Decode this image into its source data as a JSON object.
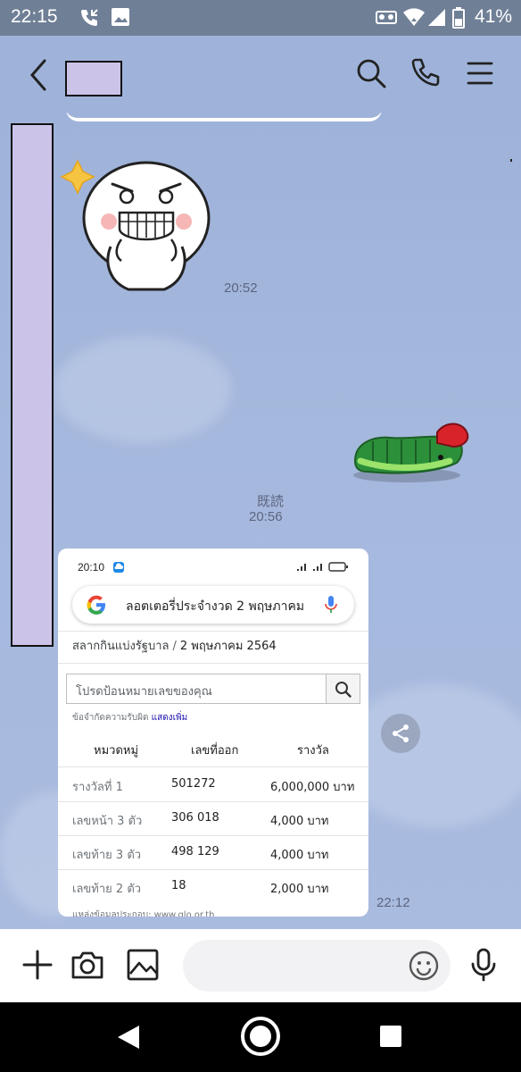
{
  "status_bar": {
    "time": "22:15",
    "battery": "41%",
    "icons": [
      "phone-call-icon",
      "image-icon",
      "vibrate-icon",
      "wifi-icon",
      "signal-icon",
      "battery-icon"
    ]
  },
  "header": {
    "icons": [
      "back-icon",
      "search-icon",
      "phone-icon",
      "menu-icon"
    ]
  },
  "messages": {
    "sticker_time": "20:52",
    "read_label": "既読",
    "sent_time": "20:56",
    "image_time": "22:12"
  },
  "screenshot_card": {
    "status_time": "20:10",
    "search_query": "ลอตเตอรี่ประจำงวด 2 พฤษภาคม",
    "breadcrumb_source": "สลากกินแบ่งรัฐบาล",
    "breadcrumb_date": "2 พฤษภาคม 2564",
    "number_placeholder": "โปรดป้อนหมายเลขของคุณ",
    "note_text": "ข้อจำกัดความรับผิด",
    "note_link": "แสดงเพิ่ม",
    "columns": [
      "หมวดหมู่",
      "เลขที่ออก",
      "รางวัล"
    ],
    "rows": [
      {
        "category": "รางวัลที่ 1",
        "number": "501272",
        "prize": "6,000,000 บาท"
      },
      {
        "category": "เลขหน้า 3 ตัว",
        "number": "306 018",
        "prize": "4,000 บาท"
      },
      {
        "category": "เลขท้าย 3 ตัว",
        "number": "498 129",
        "prize": "4,000 บาท"
      },
      {
        "category": "เลขท้าย 2 ตัว",
        "number": "18",
        "prize": "2,000 บาท"
      }
    ],
    "source_text": "แหล่งข้อมูลประกอบ: www.glo.or.th"
  },
  "input_bar": {
    "message_placeholder": "",
    "icons": [
      "plus-icon",
      "camera-icon",
      "gallery-icon",
      "emoji-icon",
      "microphone-icon"
    ]
  },
  "nav_bar": {
    "icons": [
      "nav-back-icon",
      "nav-home-icon",
      "nav-recents-icon"
    ]
  }
}
